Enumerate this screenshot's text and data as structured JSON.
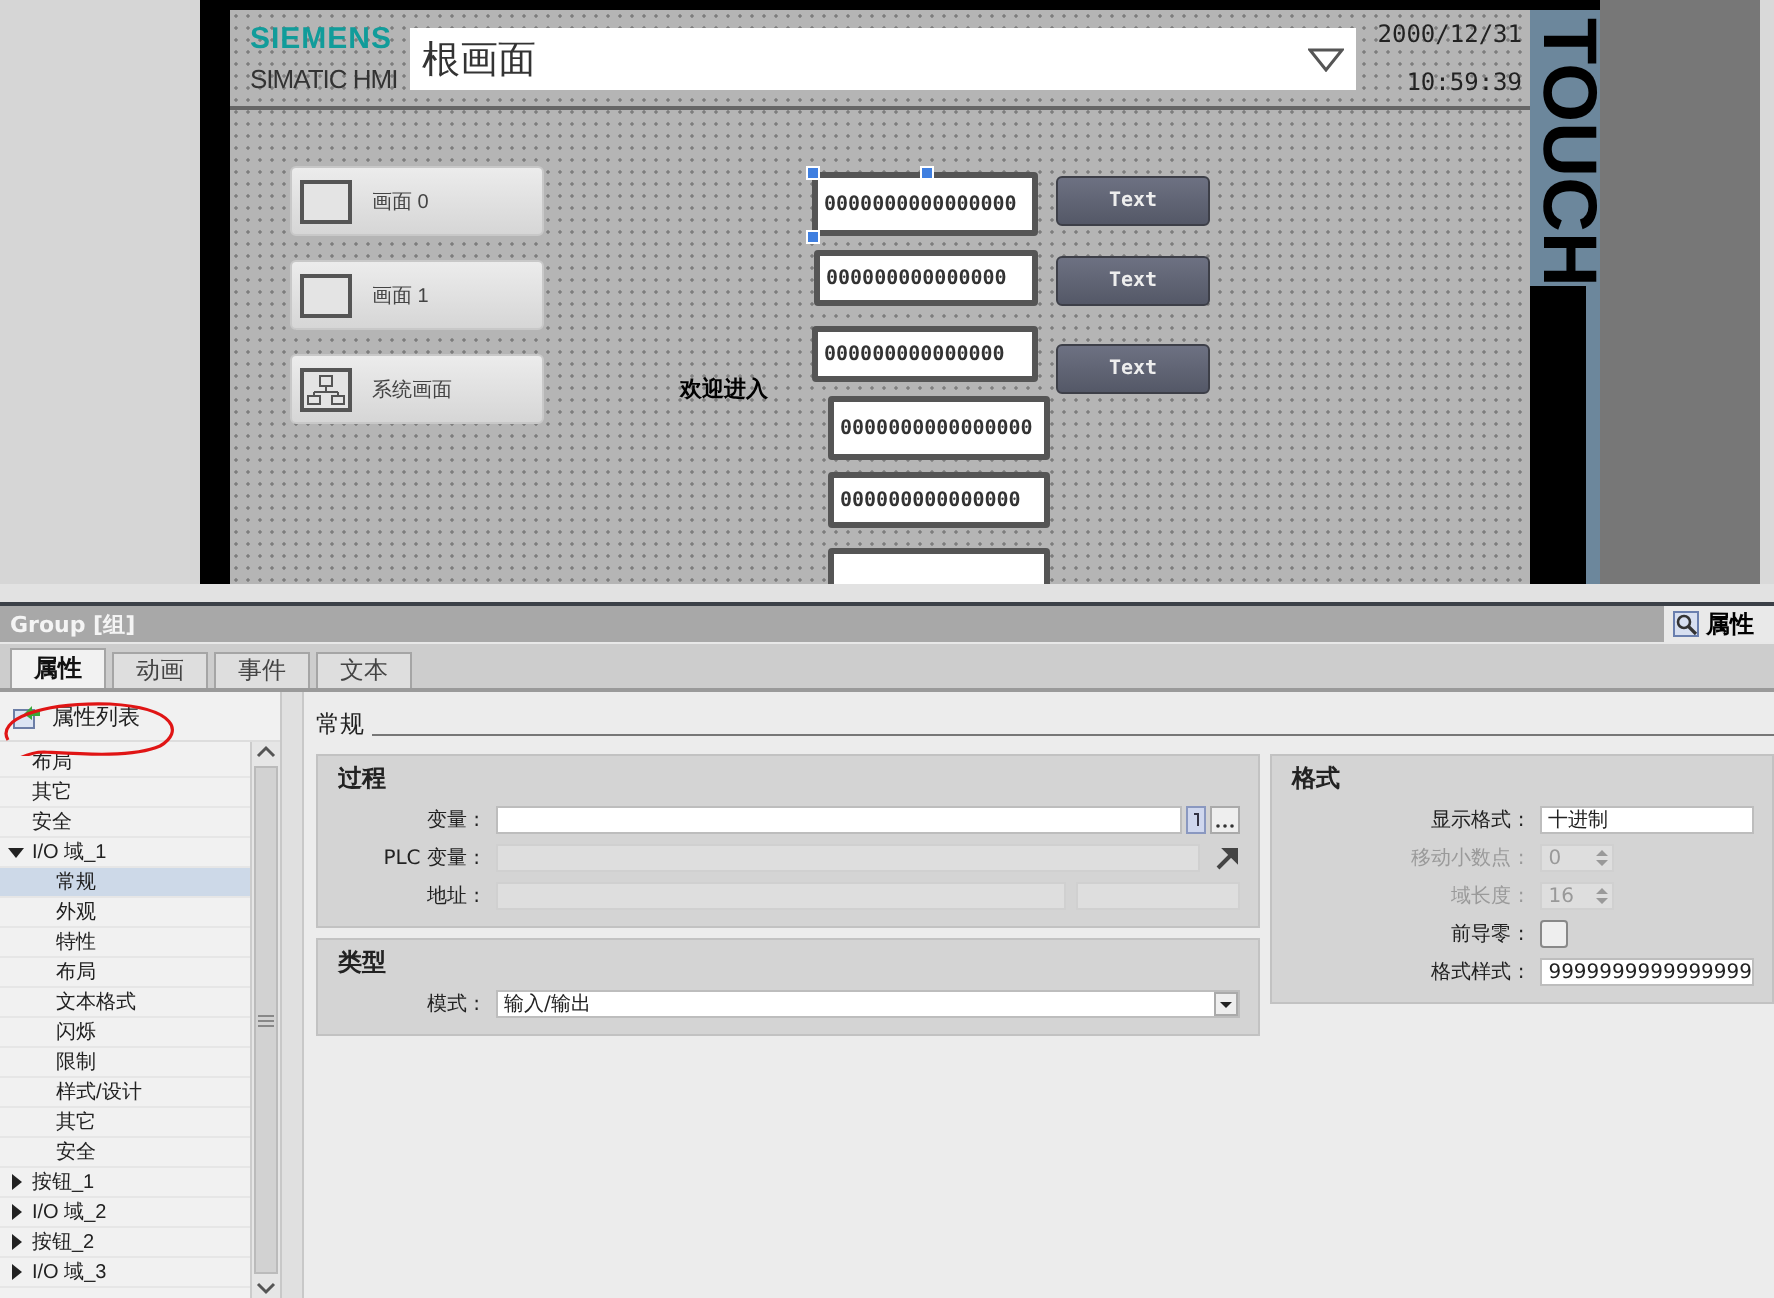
{
  "hmi_screen": {
    "logo": "SIEMENS",
    "product": "SIMATIC HMI",
    "screen_title": "根画面",
    "date": "2000/12/31",
    "time": "10:59:39",
    "side_brand": "TOUCH",
    "screen_buttons": [
      {
        "label": "画面 0",
        "kind": "screen"
      },
      {
        "label": "画面 1",
        "kind": "screen"
      },
      {
        "label": "系统画面",
        "kind": "system"
      }
    ],
    "io_fields": [
      {
        "value": "0000000000000000",
        "selected": true
      },
      {
        "value": "000000000000000",
        "selected": false
      },
      {
        "value": "000000000000000",
        "selected": false
      },
      {
        "value": "0000000000000000",
        "selected": false
      },
      {
        "value": "000000000000000",
        "selected": false
      },
      {
        "selected": false
      }
    ],
    "text_buttons": [
      {
        "label": "Text"
      },
      {
        "label": "Text"
      },
      {
        "label": "Text"
      }
    ],
    "welcome_text": "欢迎进入"
  },
  "inspector": {
    "title": "Group [组]",
    "view_tab": "属性",
    "tabs": [
      {
        "label": "属性",
        "selected": true
      },
      {
        "label": "动画",
        "selected": false
      },
      {
        "label": "事件",
        "selected": false
      },
      {
        "label": "文本",
        "selected": false
      }
    ],
    "property_list": "属性列表",
    "tree": [
      {
        "label": "布局",
        "selected": false
      },
      {
        "label": "其它",
        "selected": false
      },
      {
        "label": "安全",
        "selected": false
      },
      {
        "label": "I/O 域_1",
        "selected": false,
        "expanded": true,
        "children": [
          {
            "label": "常规",
            "selected": true
          },
          {
            "label": "外观",
            "selected": false
          },
          {
            "label": "特性",
            "selected": false
          },
          {
            "label": "布局",
            "selected": false
          },
          {
            "label": "文本格式",
            "selected": false
          },
          {
            "label": "闪烁",
            "selected": false
          },
          {
            "label": "限制",
            "selected": false
          },
          {
            "label": "样式/设计",
            "selected": false
          },
          {
            "label": "其它",
            "selected": false
          },
          {
            "label": "安全",
            "selected": false
          }
        ]
      },
      {
        "label": "按钮_1",
        "selected": false,
        "expanded": false
      },
      {
        "label": "I/O 域_2",
        "selected": false,
        "expanded": false
      },
      {
        "label": "按钮_2",
        "selected": false,
        "expanded": false
      },
      {
        "label": "I/O 域_3",
        "selected": false,
        "expanded": false
      }
    ],
    "section": "常规",
    "process": {
      "title": "过程",
      "fields": [
        {
          "label": "变量 :",
          "kind": "tag"
        },
        {
          "label": "PLC 变量 :",
          "kind": "plc"
        },
        {
          "label": "地址 :",
          "kind": "address"
        }
      ]
    },
    "type": {
      "title": "类型",
      "fields": [
        {
          "label": "模式 :",
          "kind": "dropdown",
          "value": "输入/输出"
        }
      ]
    },
    "format": {
      "title": "格式",
      "fields": [
        {
          "label": "显示格式 :",
          "kind": "text",
          "value": "十进制",
          "disabled": false
        },
        {
          "label": "移动小数点 :",
          "kind": "spin",
          "value": "0",
          "disabled": true
        },
        {
          "label": "域长度 :",
          "kind": "spin",
          "value": "16",
          "disabled": true
        },
        {
          "label": "前导零 :",
          "kind": "checkbox",
          "checked": false,
          "disabled": false
        },
        {
          "label": "格式样式 :",
          "kind": "text",
          "value": "9999999999999999",
          "disabled": false
        }
      ]
    }
  }
}
